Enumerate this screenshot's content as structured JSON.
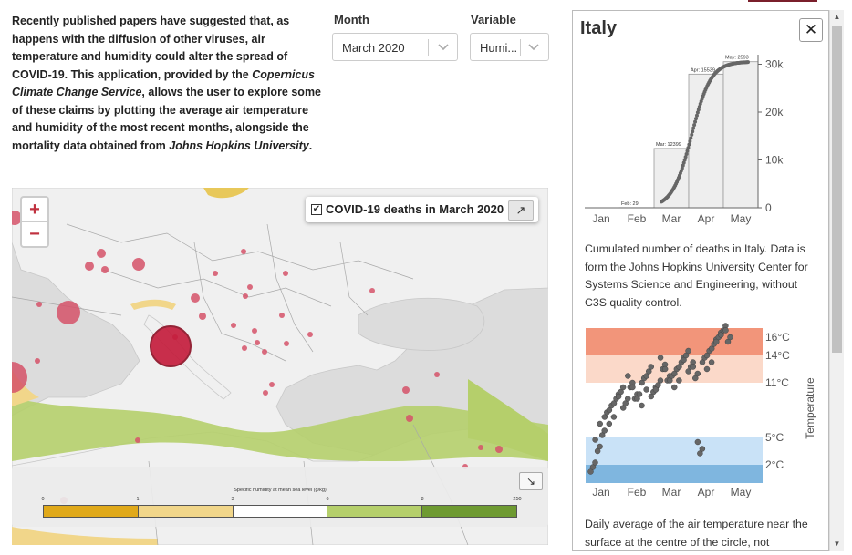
{
  "intro": {
    "part1": "Recently published papers have suggested that, as happens with the diffusion of other viruses, air temperature and humidity could alter the spread of COVID-19. This application, provided by the ",
    "emph1": "Copernicus Climate Change Service",
    "part2": ", allows the user to explore some of these claims by plotting the average air temperature and humidity of the most recent months, alongside the mortality data obtained from ",
    "emph2": "Johns Hopkins University",
    "part3": "."
  },
  "controls": {
    "month_label": "Month",
    "month_value": "March 2020",
    "variable_label": "Variable",
    "variable_value": "Humi..."
  },
  "map": {
    "zoom_in": "+",
    "zoom_out": "−",
    "layer_checkbox": "✔",
    "layer_label": "COVID-19 deaths in March 2020",
    "expand_icon": "↗",
    "legend": {
      "title": "Specific humidity at mean sea level (g/kg)",
      "ticks": [
        "0",
        "1",
        "3",
        "6",
        "8",
        "250"
      ],
      "colors": [
        "#e0a91a",
        "#f1d68a",
        "#ffffff",
        "#b5cf6b",
        "#6e9a31"
      ],
      "collapse_icon": "↘"
    }
  },
  "panel": {
    "title": "Italy",
    "close_icon": "✕",
    "deaths_chart": {
      "y_ticks": [
        "30k",
        "20k",
        "10k",
        "0"
      ],
      "x_ticks": [
        "Jan",
        "Feb",
        "Mar",
        "Apr",
        "May"
      ],
      "annotations": [
        "Feb: 29",
        "Mar: 12399",
        "Apr: 15539",
        "May: 2593"
      ],
      "description": "Cumulated number of deaths in Italy. Data is form the Johns Hopkins University Center for Systems Science and Engineering, without C3S quality control."
    },
    "temp_chart": {
      "y_ticks": [
        "16°C",
        "14°C",
        "11°C",
        "5°C",
        "2°C"
      ],
      "y_label": "Temperature",
      "x_ticks": [
        "Jan",
        "Feb",
        "Mar",
        "Apr",
        "May"
      ],
      "band_colors": [
        "#f2957a",
        "#fbd9c9",
        "#c9e2f7",
        "#7fb6df"
      ],
      "point_color": "#666666",
      "description": "Daily average of the air temperature near the surface at the centre of the circle, not"
    }
  },
  "scrollbar": {
    "up": "▲",
    "down": "▼"
  },
  "chart_data": [
    {
      "type": "line",
      "x": [
        "Jan",
        "Feb",
        "Mar",
        "Apr",
        "May"
      ],
      "series": [
        {
          "values": [
            0,
            29,
            12399,
            27938,
            30531
          ]
        }
      ],
      "ylim": [
        0,
        32000
      ]
    },
    {
      "type": "scatter",
      "ylabel": "Temperature",
      "x": [
        "Jan",
        "Feb",
        "Mar",
        "Apr",
        "May"
      ],
      "series": [
        {
          "values": [
            2,
            4,
            6,
            7,
            8,
            9,
            10,
            9,
            11,
            10,
            9,
            11,
            12,
            10,
            11,
            13,
            12,
            11,
            12,
            13,
            14,
            13,
            12,
            4,
            13,
            14,
            15,
            16,
            17,
            16
          ]
        }
      ],
      "bands": [
        [
          14,
          17
        ],
        [
          11,
          14
        ],
        [
          5,
          3
        ],
        [
          2,
          0
        ]
      ],
      "ylim": [
        0,
        17
      ]
    }
  ]
}
